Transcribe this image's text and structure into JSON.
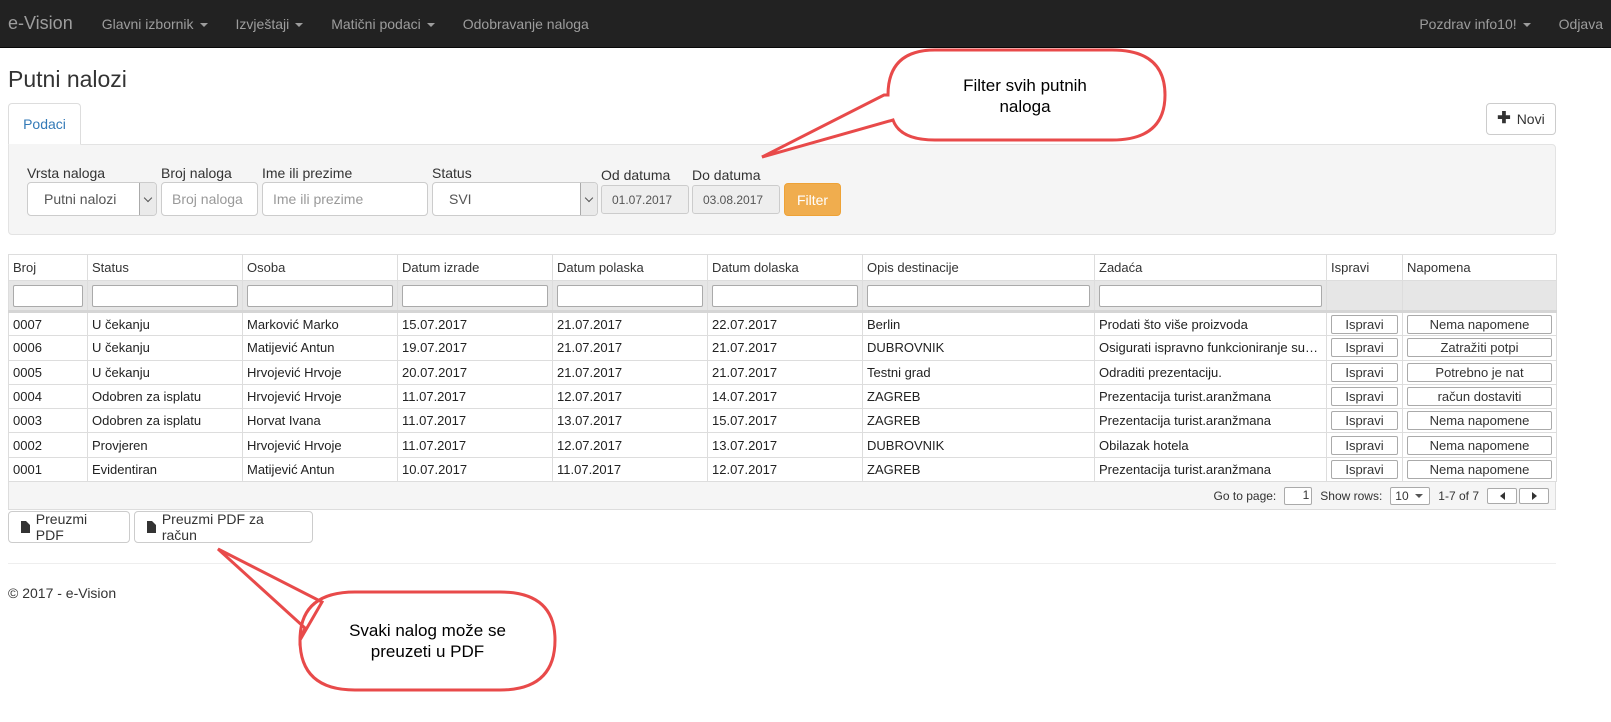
{
  "navbar": {
    "brand": "e-Vision",
    "menu": [
      {
        "label": "Glavni izbornik",
        "dropdown": true
      },
      {
        "label": "Izvještaji",
        "dropdown": true
      },
      {
        "label": "Matični podaci",
        "dropdown": true
      },
      {
        "label": "Odobravanje naloga",
        "dropdown": false
      }
    ],
    "greeting": "Pozdrav info10!",
    "logout": "Odjava"
  },
  "page": {
    "title": "Putni nalozi",
    "tab_label": "Podaci",
    "new_button": "Novi"
  },
  "filter": {
    "vrsta_label": "Vrsta naloga",
    "vrsta_value": "Putni nalozi",
    "broj_label": "Broj naloga",
    "broj_placeholder": "Broj naloga",
    "ime_label": "Ime ili prezime",
    "ime_placeholder": "Ime ili prezime",
    "status_label": "Status",
    "status_value": "SVI",
    "od_label": "Od datuma",
    "od_value": "01.07.2017",
    "do_label": "Do datuma",
    "do_value": "03.08.2017",
    "button": "Filter"
  },
  "grid": {
    "columns": [
      "Broj",
      "Status",
      "Osoba",
      "Datum izrade",
      "Datum polaska",
      "Datum dolaska",
      "Opis destinacije",
      "Zadaća",
      "Ispravi",
      "Napomena"
    ],
    "rows": [
      {
        "broj": "0007",
        "status": "U čekanju",
        "osoba": "Marković Marko",
        "izrada": "15.07.2017",
        "polazak": "21.07.2017",
        "dolazak": "22.07.2017",
        "destinacija": "Berlin",
        "zadaca": "Prodati što više proizvoda",
        "ispravi": "Ispravi",
        "napomena": "Nema napomene"
      },
      {
        "broj": "0006",
        "status": "U čekanju",
        "osoba": "Matijević Antun",
        "izrada": "19.07.2017",
        "polazak": "21.07.2017",
        "dolazak": "21.07.2017",
        "destinacija": "DUBROVNIK",
        "zadaca": "Osigurati ispravno funkcioniranje sust…",
        "ispravi": "Ispravi",
        "napomena": "Zatražiti potpi"
      },
      {
        "broj": "0005",
        "status": "U čekanju",
        "osoba": "Hrvojević Hrvoje",
        "izrada": "20.07.2017",
        "polazak": "21.07.2017",
        "dolazak": "21.07.2017",
        "destinacija": "Testni grad",
        "zadaca": "Odraditi prezentaciju.",
        "ispravi": "Ispravi",
        "napomena": "Potrebno je nat"
      },
      {
        "broj": "0004",
        "status": "Odobren za isplatu",
        "osoba": "Hrvojević Hrvoje",
        "izrada": "11.07.2017",
        "polazak": "12.07.2017",
        "dolazak": "14.07.2017",
        "destinacija": "ZAGREB",
        "zadaca": "Prezentacija turist.aranžmana",
        "ispravi": "Ispravi",
        "napomena": "račun dostaviti"
      },
      {
        "broj": "0003",
        "status": "Odobren za isplatu",
        "osoba": "Horvat Ivana",
        "izrada": "11.07.2017",
        "polazak": "13.07.2017",
        "dolazak": "15.07.2017",
        "destinacija": "ZAGREB",
        "zadaca": "Prezentacija turist.aranžmana",
        "ispravi": "Ispravi",
        "napomena": "Nema napomene"
      },
      {
        "broj": "0002",
        "status": "Provjeren",
        "osoba": "Hrvojević Hrvoje",
        "izrada": "11.07.2017",
        "polazak": "12.07.2017",
        "dolazak": "13.07.2017",
        "destinacija": "DUBROVNIK",
        "zadaca": "Obilazak hotela",
        "ispravi": "Ispravi",
        "napomena": "Nema napomene"
      },
      {
        "broj": "0001",
        "status": "Evidentiran",
        "osoba": "Matijević Antun",
        "izrada": "10.07.2017",
        "polazak": "11.07.2017",
        "dolazak": "12.07.2017",
        "destinacija": "ZAGREB",
        "zadaca": "Prezentacija turist.aranžmana",
        "ispravi": "Ispravi",
        "napomena": "Nema napomene"
      }
    ],
    "pager": {
      "goto_label": "Go to page:",
      "page_value": "1",
      "rows_label": "Show rows:",
      "rows_value": "10",
      "range": "1-7 of 7"
    }
  },
  "actions": {
    "pdf": "Preuzmi PDF",
    "pdf_racun": "Preuzmi PDF za račun"
  },
  "footer": "© 2017 - e-Vision",
  "callouts": {
    "top_line1": "Filter svih putnih",
    "top_line2": "naloga",
    "bottom_line1": "Svaki nalog može se",
    "bottom_line2": "preuzeti u PDF",
    "stroke_color": "#e84a4a"
  },
  "colors": {
    "navbar_bg": "#222222",
    "link": "#337ab7",
    "filter_button": "#f0ad4e"
  }
}
